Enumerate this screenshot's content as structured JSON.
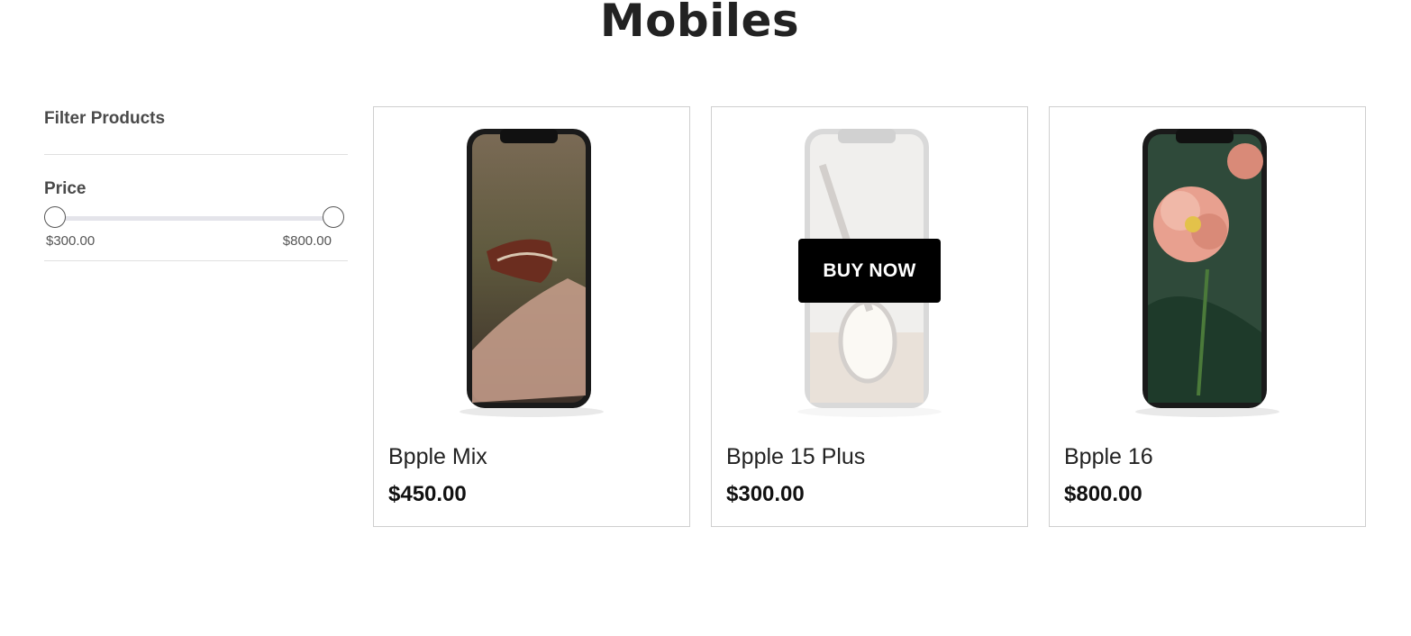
{
  "page": {
    "title": "Mobiles"
  },
  "sidebar": {
    "filter_title": "Filter Products",
    "price_label": "Price",
    "range_min_label": "$300.00",
    "range_max_label": "$800.00"
  },
  "products": [
    {
      "name": "Bpple Mix",
      "price": "$450.00",
      "screen": "butterfly-on-hand"
    },
    {
      "name": "Bpple 15 Plus",
      "price": "$300.00",
      "screen": "guitar",
      "hovered": true,
      "button_label": "BUY NOW"
    },
    {
      "name": "Bpple 16",
      "price": "$800.00",
      "screen": "peony-flower"
    }
  ],
  "colors": {
    "button_bg": "#000000",
    "button_text": "#ffffff",
    "card_border": "#cfcfcf"
  }
}
